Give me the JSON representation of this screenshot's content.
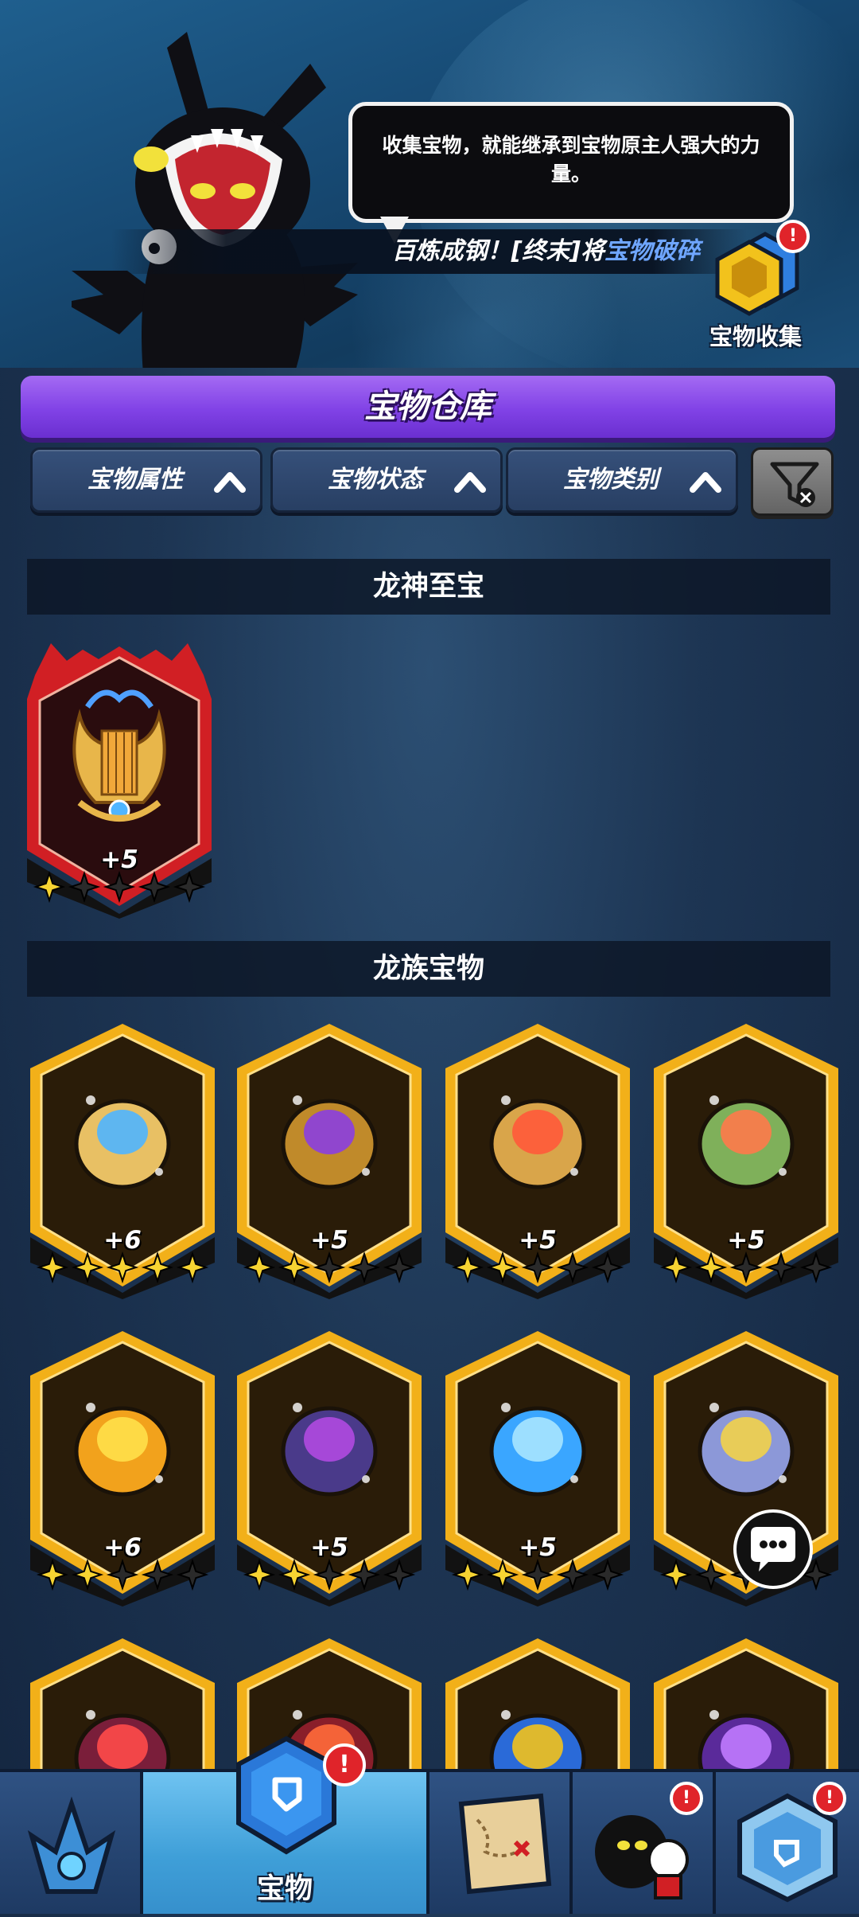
{
  "banner": {
    "speech_text": "收集宝物，就能继承到宝物原主人强大的力量。",
    "ticker_prefix": "百炼成钢！[终末]将",
    "ticker_highlight": "宝物破碎",
    "collection_label": "宝物收集",
    "collection_badge": "!"
  },
  "title": "宝物仓库",
  "filters": {
    "attribute_label": "宝物属性",
    "status_label": "宝物状态",
    "category_label": "宝物类别"
  },
  "sections": {
    "supreme_title": "龙神至宝",
    "clan_title": "龙族宝物"
  },
  "supreme_treasures": [
    {
      "icon": "golden-lyre-icon",
      "level": "+5",
      "stars": 1,
      "max_stars": 5
    }
  ],
  "clan_treasures": [
    {
      "icon": "ice-horn-icon",
      "level": "+6",
      "stars": 5,
      "max_stars": 5
    },
    {
      "icon": "purple-horn-icon",
      "level": "+5",
      "stars": 2,
      "max_stars": 5
    },
    {
      "icon": "fire-bowl-icon",
      "level": "+5",
      "stars": 2,
      "max_stars": 5
    },
    {
      "icon": "fish-plate-icon",
      "level": "+5",
      "stars": 2,
      "max_stars": 5
    },
    {
      "icon": "battery-box-icon",
      "level": "+6",
      "stars": 2,
      "max_stars": 5
    },
    {
      "icon": "dark-chest-icon",
      "level": "+5",
      "stars": 2,
      "max_stars": 5
    },
    {
      "icon": "ice-dragon-statue-icon",
      "level": "+5",
      "stars": 2,
      "max_stars": 5
    },
    {
      "icon": "rabbit-charm-icon",
      "level": "",
      "stars": 1,
      "max_stars": 5
    },
    {
      "icon": "red-bird-icon",
      "level": "",
      "stars": 0,
      "max_stars": 5
    },
    {
      "icon": "red-orb-icon",
      "level": "",
      "stars": 0,
      "max_stars": 5
    },
    {
      "icon": "blue-crown-icon",
      "level": "",
      "stars": 0,
      "max_stars": 5
    },
    {
      "icon": "purple-ring-icon",
      "level": "",
      "stars": 0,
      "max_stars": 5
    }
  ],
  "nav": {
    "active_label": "宝物",
    "badge": "!"
  },
  "colors": {
    "title_purple": "#8142e6",
    "gold_frame": "#f2b019",
    "red_frame": "#d11f24",
    "star_gold": "#f7d432",
    "badge_red": "#e0242a",
    "nav_active": "#4fb0e6"
  }
}
